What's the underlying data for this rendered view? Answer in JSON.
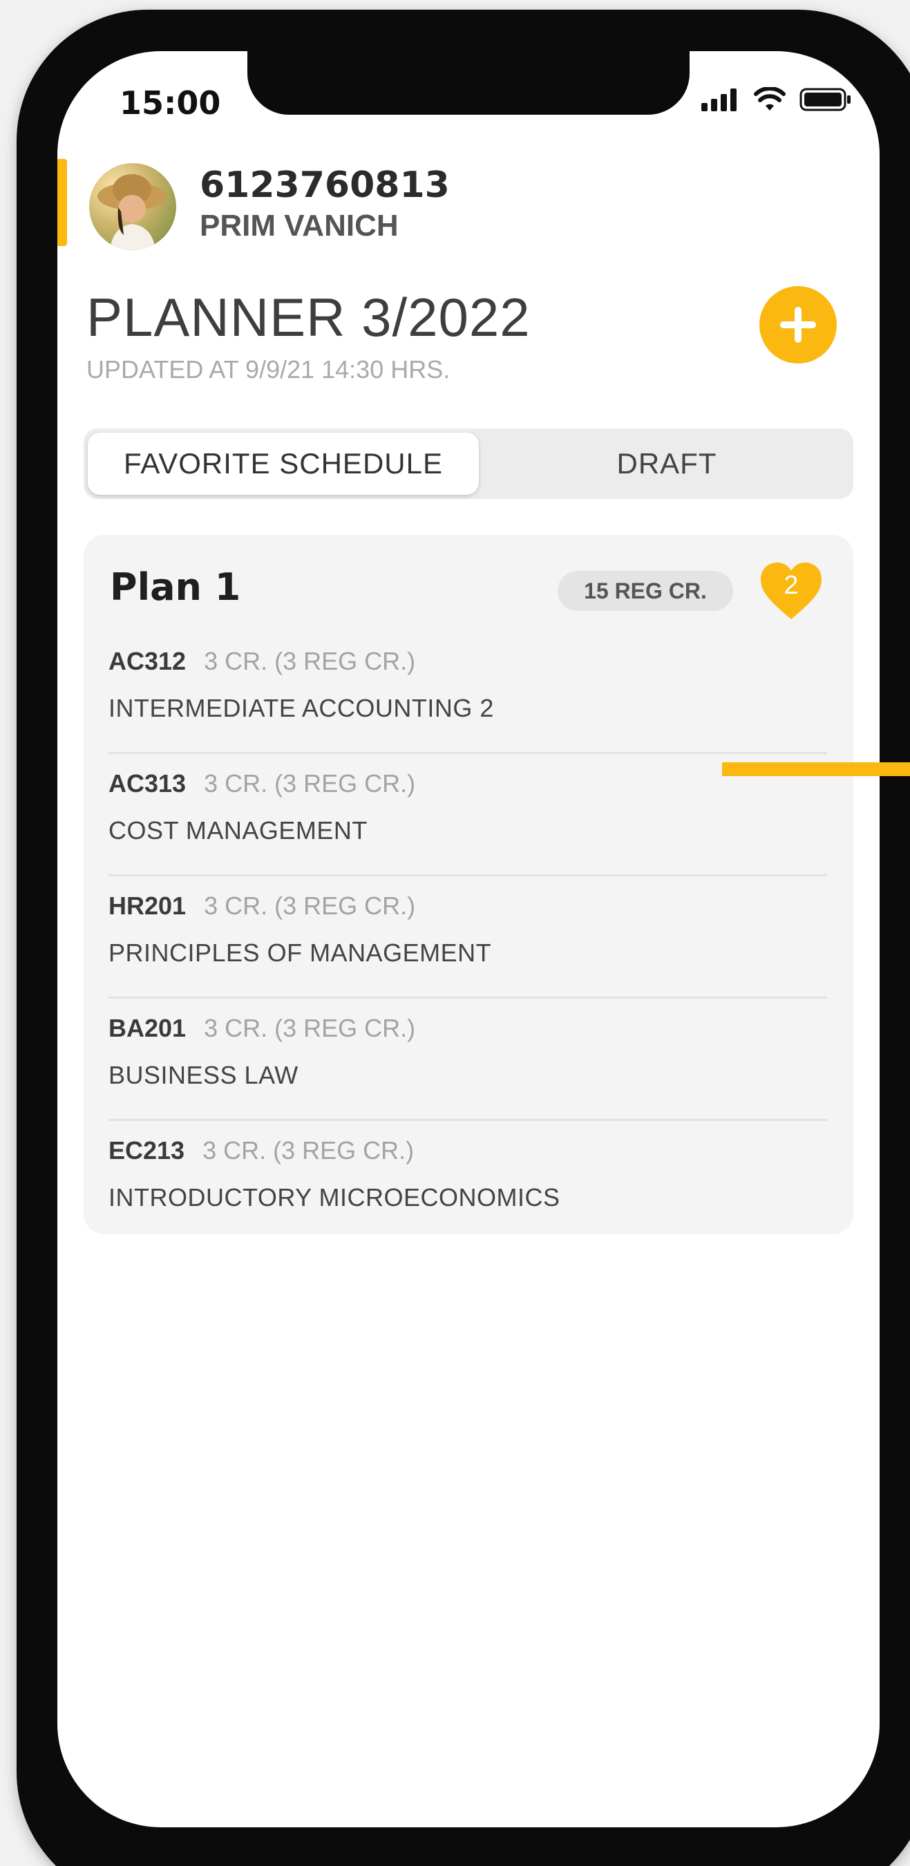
{
  "status_bar": {
    "time": "15:00"
  },
  "user": {
    "id": "6123760813",
    "name": "PRIM VANICH"
  },
  "planner": {
    "title": "PLANNER 3/2022",
    "updated": "UPDATED AT 9/9/21 14:30 HRS."
  },
  "tabs": [
    {
      "label": "FAVORITE SCHEDULE",
      "active": true
    },
    {
      "label": "DRAFT",
      "active": false
    }
  ],
  "plan": {
    "title": "Plan 1",
    "credits": "15 REG CR.",
    "favorite_count": "2",
    "courses": [
      {
        "code": "AC312",
        "credits": "3 CR. (3 REG CR.)",
        "name": "INTERMEDIATE ACCOUNTING 2"
      },
      {
        "code": "AC313",
        "credits": "3 CR. (3 REG CR.)",
        "name": "COST MANAGEMENT"
      },
      {
        "code": "HR201",
        "credits": "3 CR. (3 REG CR.)",
        "name": "PRINCIPLES OF MANAGEMENT"
      },
      {
        "code": "BA201",
        "credits": "3 CR. (3 REG CR.)",
        "name": "BUSINESS LAW"
      },
      {
        "code": "EC213",
        "credits": "3 CR. (3 REG CR.)",
        "name": "INTRODUCTORY MICROECONOMICS"
      }
    ]
  },
  "colors": {
    "accent": "#fbb811",
    "text_dark": "#3e3e3e",
    "text_muted": "#a9a9a9",
    "card_bg": "#f4f4f4"
  },
  "icons": [
    "signal-icon",
    "wifi-icon",
    "battery-icon",
    "plus-icon",
    "heart-icon"
  ]
}
